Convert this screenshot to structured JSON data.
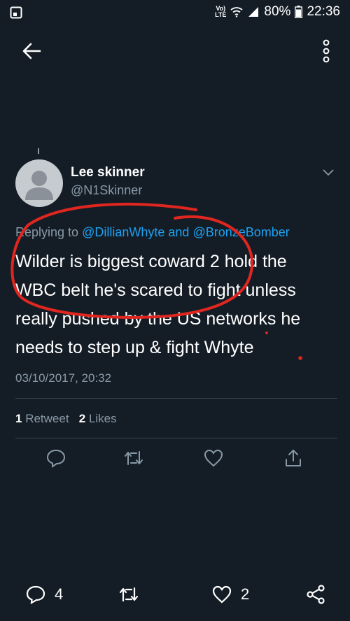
{
  "status_bar": {
    "lte_top": "Vo)",
    "lte_bottom": "LTE",
    "battery": "80%",
    "time": "22:36"
  },
  "tweet": {
    "author_name": "Lee skinner",
    "author_handle": "@N1Skinner",
    "reply_prefix": "Replying to",
    "reply_mention_1": "@DillianWhyte",
    "reply_and": "and",
    "reply_mention_2": "@BronzeBomber",
    "text_line_1": "Wilder is biggest coward 2 hold the",
    "text_line_2": "WBC belt he's scared to fight unless",
    "text_line_3": "really pushed by the US networks he",
    "text_line_4": "needs to step up & fight Whyte",
    "timestamp": "03/10/2017, 20:32"
  },
  "stats": {
    "retweets_count": "1",
    "retweets_label": "Retweet",
    "likes_count": "2",
    "likes_label": "Likes"
  },
  "bottom_bar": {
    "replies_count": "4",
    "likes_count": "2"
  },
  "colors": {
    "background": "#141d26",
    "secondary_text": "#8899a6",
    "link": "#1da1f2",
    "divider": "#38444d",
    "annotation": "#e0261f"
  }
}
